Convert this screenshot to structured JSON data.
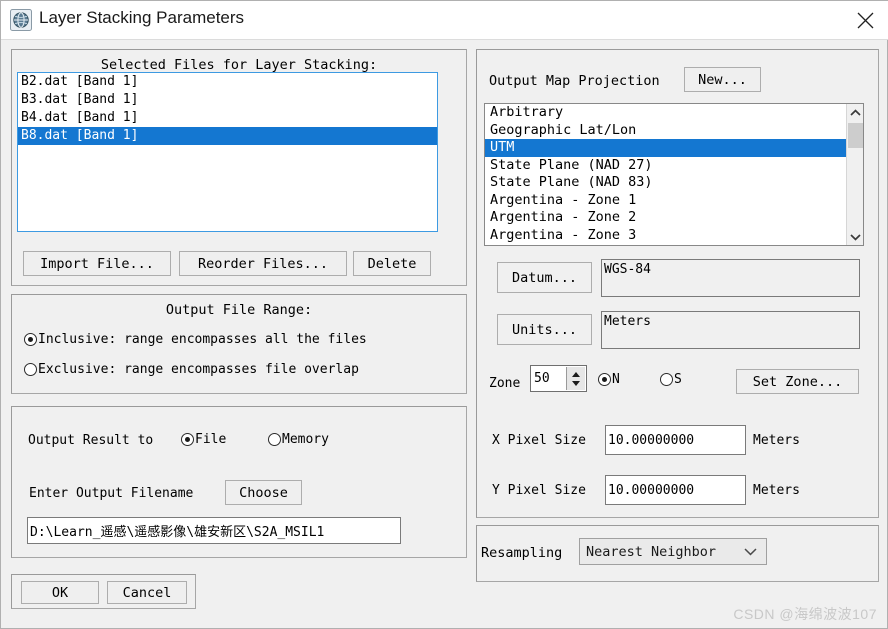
{
  "window": {
    "title": "Layer Stacking Parameters",
    "icon": "envi-globe-icon",
    "close_icon": "close-icon"
  },
  "left": {
    "files_group": {
      "title": "Selected Files for Layer Stacking:",
      "items": [
        {
          "label": "B2.dat [Band 1]",
          "selected": false
        },
        {
          "label": "B3.dat [Band 1]",
          "selected": false
        },
        {
          "label": "B4.dat [Band 1]",
          "selected": false
        },
        {
          "label": "B8.dat [Band 1]",
          "selected": true
        }
      ],
      "buttons": {
        "import": "Import File...",
        "reorder": "Reorder Files...",
        "delete": "Delete"
      }
    },
    "range_group": {
      "title": "Output File Range:",
      "options": [
        {
          "label": "Inclusive: range encompasses all the files",
          "selected": true
        },
        {
          "label": "Exclusive: range encompasses file overlap",
          "selected": false
        }
      ]
    },
    "output_group": {
      "result_label": "Output Result to",
      "result_options": [
        {
          "label": "File",
          "selected": true
        },
        {
          "label": "Memory",
          "selected": false
        }
      ],
      "filename_label": "Enter Output Filename",
      "choose_button": "Choose",
      "filename_value": "D:\\Learn_遥感\\遥感影像\\雄安新区\\S2A_MSIL1"
    },
    "footer": {
      "ok": "OK",
      "cancel": "Cancel"
    }
  },
  "right": {
    "projection_group": {
      "label": "Output Map Projection",
      "new_button": "New...",
      "items": [
        {
          "label": "Arbitrary",
          "selected": false
        },
        {
          "label": "Geographic Lat/Lon",
          "selected": false
        },
        {
          "label": "UTM",
          "selected": true
        },
        {
          "label": "State Plane (NAD 27)",
          "selected": false
        },
        {
          "label": "State Plane (NAD 83)",
          "selected": false
        },
        {
          "label": "Argentina - Zone 1",
          "selected": false
        },
        {
          "label": "Argentina - Zone 2",
          "selected": false
        },
        {
          "label": "Argentina - Zone 3",
          "selected": false
        }
      ],
      "datum_button": "Datum...",
      "datum_value": "WGS-84",
      "units_button": "Units...",
      "units_value": "Meters",
      "zone_label": "Zone",
      "zone_value": "50",
      "hemisphere": [
        {
          "label": "N",
          "selected": true
        },
        {
          "label": "S",
          "selected": false
        }
      ],
      "set_zone_button": "Set Zone..."
    },
    "pixel_group": {
      "x_label": "X Pixel Size",
      "x_value": "10.00000000",
      "x_units": "Meters",
      "y_label": "Y Pixel Size",
      "y_value": "10.00000000",
      "y_units": "Meters"
    },
    "resampling_group": {
      "label": "Resampling",
      "value": "Nearest Neighbor"
    }
  },
  "watermark": "CSDN @海绵波波107",
  "colors": {
    "selection_blue": "#1477d1",
    "dialog_bg": "#f0f0f0",
    "list_border_blue": "#3d9ae2"
  }
}
